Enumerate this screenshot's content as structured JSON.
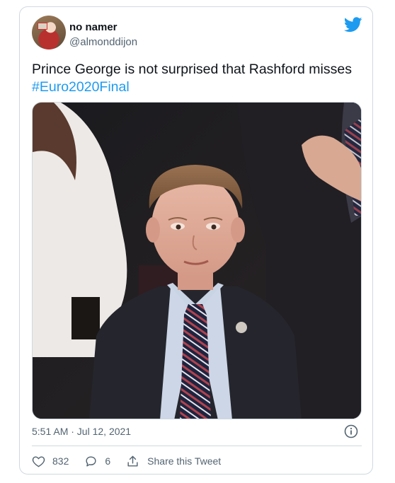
{
  "author": {
    "name": "no namer",
    "handle": "@almonddijon"
  },
  "tweet": {
    "text": "Prince George is not surprised that Rashford misses",
    "hashtag": "#Euro2020Final"
  },
  "meta": {
    "timestamp": "5:51 AM · Jul 12, 2021"
  },
  "actions": {
    "likes": "832",
    "replies": "6",
    "share_label": "Share this Tweet"
  },
  "colors": {
    "twitter_blue": "#1d9bf0",
    "text_secondary": "#536471",
    "border": "#cfd9de"
  },
  "icons": [
    "twitter-bird-icon",
    "info-icon",
    "heart-icon",
    "reply-icon",
    "share-icon"
  ]
}
